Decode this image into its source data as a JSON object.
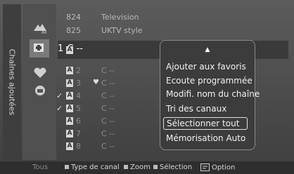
{
  "side_title": "Chaînes ajoutées",
  "icons": [
    "all-channels-icon",
    "added-channels-icon",
    "favorites-icon",
    "locked-icon"
  ],
  "top_channels": [
    {
      "num": "824",
      "name": "Television"
    },
    {
      "num": "825",
      "name": "UKTV style"
    }
  ],
  "selected_channel": {
    "badge": "A",
    "num": "1",
    "name": "C --"
  },
  "channels": [
    {
      "badge": "A",
      "num": "2",
      "name": "C --",
      "check": "",
      "heart": ""
    },
    {
      "badge": "A",
      "num": "3",
      "name": "C --",
      "check": "",
      "heart": "♥"
    },
    {
      "badge": "A",
      "num": "4",
      "name": "C --",
      "check": "✓",
      "heart": ""
    },
    {
      "badge": "A",
      "num": "5",
      "name": "C --",
      "check": "✓",
      "heart": ""
    },
    {
      "badge": "A",
      "num": "6",
      "name": "C --",
      "check": "",
      "heart": ""
    },
    {
      "badge": "A",
      "num": "7",
      "name": "C --",
      "check": "",
      "heart": ""
    },
    {
      "badge": "A",
      "num": "8",
      "name": "C --",
      "check": "",
      "heart": ""
    }
  ],
  "popup": {
    "up_arrow": "▲",
    "items": [
      "Ajouter aux favoris",
      "Ecoute programmée",
      "Modifi. nom du chaîne",
      "Tri des canaux",
      "Sélectionner tout",
      "Mémorisation Auto"
    ],
    "selected_index": 4
  },
  "footer": {
    "tous": "Tous",
    "type_de_canal": "Type de canal",
    "zoom": "Zoom",
    "selection": "Sélection",
    "option": "Option"
  }
}
